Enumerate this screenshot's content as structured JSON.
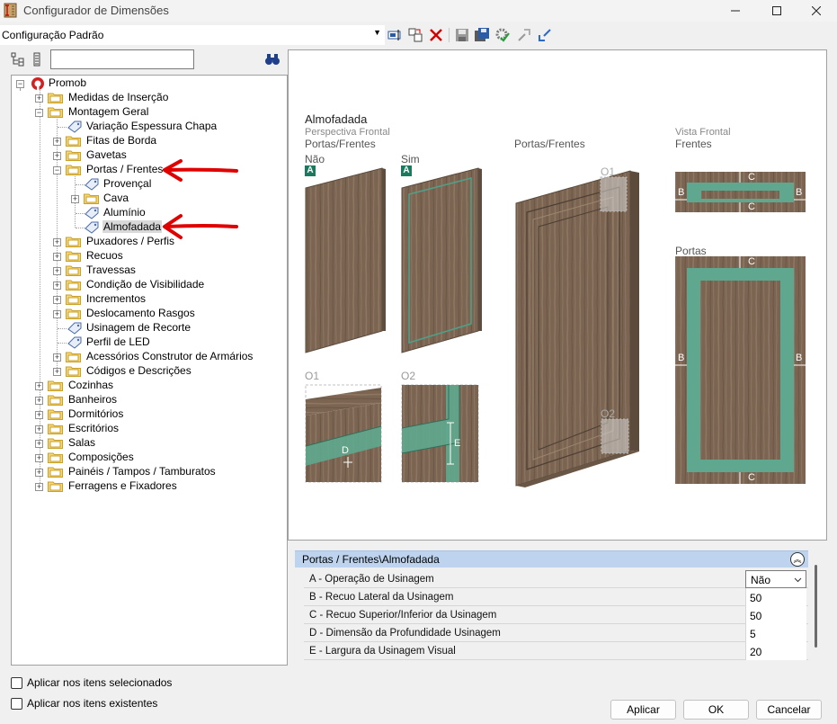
{
  "window": {
    "title": "Configurador de Dimensões"
  },
  "toolbar": {
    "config_value": "Configuração Padrão"
  },
  "tree": {
    "root": "Promob",
    "items": [
      "Medidas de Inserção",
      "Montagem Geral",
      "Variação Espessura Chapa",
      "Fitas de Borda",
      "Gavetas",
      "Portas / Frentes",
      "Provençal",
      "Cava",
      "Alumínio",
      "Almofadada",
      "Puxadores / Perfis",
      "Recuos",
      "Travessas",
      "Condição de Visibilidade",
      "Incrementos",
      "Deslocamento Rasgos",
      "Usinagem de Recorte",
      "Perfil de LED",
      "Acessórios Construtor de Armários",
      "Códigos e Descrições",
      "Cozinhas",
      "Banheiros",
      "Dormitórios",
      "Escritórios",
      "Salas",
      "Composições",
      "Painéis / Tampos / Tamburatos",
      "Ferragens e Fixadores"
    ]
  },
  "checkboxes": {
    "selected_items": "Aplicar nos itens selecionados",
    "existing_items": "Aplicar nos itens existentes"
  },
  "illustration": {
    "title": "Almofadada",
    "subtitle_1": "Perspectiva Frontal",
    "subtitle_2": "Portas/Frentes",
    "option_no": "Não",
    "option_yes": "Sim",
    "badge": "A",
    "detail_o1": "O1",
    "detail_o2": "O2",
    "center_label": "Portas/Frentes",
    "front_view_1": "Vista Frontal",
    "front_view_2": "Frentes",
    "doors_label": "Portas",
    "dim_b": "B",
    "dim_c": "C",
    "dim_d": "D",
    "dim_e": "E",
    "colors": {
      "wood": "#7b6552",
      "groove": "#5fa88f"
    }
  },
  "properties": {
    "header": "Portas / Frentes\\Almofadada",
    "rows": [
      {
        "name": "A - Operação de Usinagem",
        "value": "Não"
      },
      {
        "name": "B - Recuo Lateral da Usinagem",
        "value": "50"
      },
      {
        "name": "C - Recuo Superior/Inferior da Usinagem",
        "value": "50"
      },
      {
        "name": "D - Dimensão da Profundidade Usinagem",
        "value": "5"
      },
      {
        "name": "E - Largura da Usinagem Visual",
        "value": "20"
      }
    ]
  },
  "buttons": {
    "apply": "Aplicar",
    "ok": "OK",
    "cancel": "Cancelar"
  }
}
